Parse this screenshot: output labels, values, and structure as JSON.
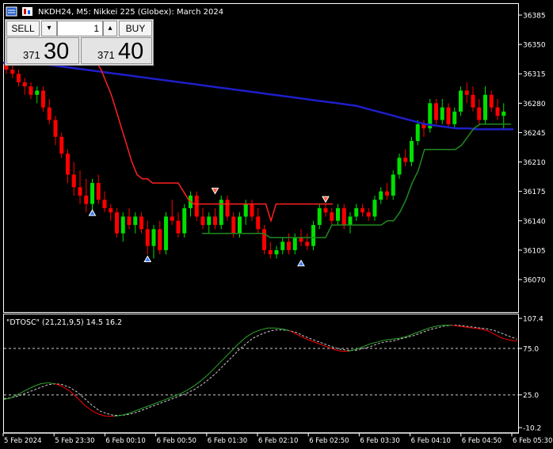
{
  "window": {
    "title": "NKDH24, M5:  Nikkei 225 (Globex): March 2024"
  },
  "trade_panel": {
    "sell_label": "SELL",
    "buy_label": "BUY",
    "volume": "1",
    "down_arrow": "▾",
    "up_arrow": "▴",
    "sell_price_small": "371",
    "sell_price_large": "30",
    "buy_price_small": "371",
    "buy_price_large": "40"
  },
  "indicator": {
    "label": "\"DTOSC\" (21,21,9,5) 14.5 16.2"
  },
  "colors": {
    "bull": "#00e000",
    "bear": "#ff0000",
    "ma": "#1e1ec8",
    "stop_red": "#ff2020",
    "stop_green": "#1f8a1f",
    "osc_main": "#2fa82f",
    "osc_signal": "#c8c8c8",
    "grid": "#ffffff",
    "axis_text": "#ffffff"
  },
  "chart_data": [
    {
      "type": "candlestick",
      "price_axis_ticks": [
        "36385",
        "36350",
        "36315",
        "36280",
        "36245",
        "36210",
        "36175",
        "36140",
        "36105",
        "36070"
      ],
      "ylim": [
        36045,
        36400
      ],
      "x_ticks": [
        "5 Feb 2024",
        "5 Feb 23:30",
        "6 Feb 00:10",
        "6 Feb 00:50",
        "6 Feb 01:30",
        "6 Feb 02:10",
        "6 Feb 02:50",
        "6 Feb 03:30",
        "6 Feb 04:10",
        "6 Feb 04:50",
        "6 Feb 05:30"
      ],
      "candles": [
        [
          36330,
          36335,
          36315,
          36320
        ],
        [
          36320,
          36325,
          36310,
          36315
        ],
        [
          36315,
          36320,
          36300,
          36305
        ],
        [
          36305,
          36310,
          36290,
          36300
        ],
        [
          36300,
          36305,
          36285,
          36290
        ],
        [
          36290,
          36300,
          36280,
          36295
        ],
        [
          36295,
          36300,
          36270,
          36275
        ],
        [
          36275,
          36285,
          36255,
          36260
        ],
        [
          36260,
          36265,
          36230,
          36240
        ],
        [
          36240,
          36245,
          36215,
          36220
        ],
        [
          36220,
          36225,
          36185,
          36195
        ],
        [
          36195,
          36210,
          36170,
          36180
        ],
        [
          36180,
          36200,
          36160,
          36170
        ],
        [
          36170,
          36190,
          36150,
          36160
        ],
        [
          36160,
          36190,
          36150,
          36185
        ],
        [
          36185,
          36195,
          36160,
          36165
        ],
        [
          36165,
          36175,
          36150,
          36155
        ],
        [
          36155,
          36160,
          36140,
          36150
        ],
        [
          36150,
          36155,
          36120,
          36125
        ],
        [
          36125,
          36150,
          36115,
          36145
        ],
        [
          36145,
          36155,
          36130,
          36135
        ],
        [
          36135,
          36150,
          36125,
          36145
        ],
        [
          36145,
          36150,
          36125,
          36130
        ],
        [
          36130,
          36140,
          36100,
          36110
        ],
        [
          36110,
          36135,
          36095,
          36130
        ],
        [
          36130,
          36140,
          36100,
          36105
        ],
        [
          36105,
          36150,
          36100,
          36145
        ],
        [
          36145,
          36165,
          36135,
          36140
        ],
        [
          36140,
          36150,
          36120,
          36125
        ],
        [
          36125,
          36160,
          36120,
          36155
        ],
        [
          36155,
          36175,
          36145,
          36170
        ],
        [
          36170,
          36175,
          36140,
          36145
        ],
        [
          36145,
          36155,
          36130,
          36135
        ],
        [
          36135,
          36150,
          36125,
          36145
        ],
        [
          36145,
          36155,
          36130,
          36135
        ],
        [
          36135,
          36170,
          36130,
          36165
        ],
        [
          36165,
          36170,
          36140,
          36145
        ],
        [
          36145,
          36150,
          36120,
          36125
        ],
        [
          36125,
          36150,
          36120,
          36145
        ],
        [
          36145,
          36165,
          36135,
          36160
        ],
        [
          36160,
          36165,
          36140,
          36145
        ],
        [
          36145,
          36155,
          36125,
          36130
        ],
        [
          36130,
          36135,
          36100,
          36105
        ],
        [
          36105,
          36115,
          36095,
          36100
        ],
        [
          36100,
          36110,
          36095,
          36105
        ],
        [
          36105,
          36120,
          36100,
          36115
        ],
        [
          36115,
          36125,
          36100,
          36105
        ],
        [
          36105,
          36125,
          36100,
          36120
        ],
        [
          36120,
          36130,
          36110,
          36115
        ],
        [
          36115,
          36125,
          36105,
          36110
        ],
        [
          36110,
          36140,
          36105,
          36135
        ],
        [
          36135,
          36160,
          36130,
          36155
        ],
        [
          36155,
          36160,
          36145,
          36150
        ],
        [
          36150,
          36155,
          36135,
          36140
        ],
        [
          36140,
          36160,
          36135,
          36155
        ],
        [
          36155,
          36160,
          36130,
          36135
        ],
        [
          36135,
          36150,
          36125,
          36145
        ],
        [
          36145,
          36160,
          36140,
          36155
        ],
        [
          36155,
          36160,
          36145,
          36150
        ],
        [
          36150,
          36155,
          36140,
          36145
        ],
        [
          36145,
          36170,
          36140,
          36165
        ],
        [
          36165,
          36180,
          36160,
          36175
        ],
        [
          36175,
          36185,
          36165,
          36170
        ],
        [
          36170,
          36200,
          36165,
          36195
        ],
        [
          36195,
          36220,
          36190,
          36215
        ],
        [
          36215,
          36225,
          36205,
          36210
        ],
        [
          36210,
          36240,
          36205,
          36235
        ],
        [
          36235,
          36260,
          36230,
          36255
        ],
        [
          36255,
          36260,
          36240,
          36250
        ],
        [
          36250,
          36285,
          36245,
          36280
        ],
        [
          36280,
          36285,
          36255,
          36260
        ],
        [
          36260,
          36285,
          36255,
          36275
        ],
        [
          36275,
          36280,
          36250,
          36255
        ],
        [
          36255,
          36275,
          36250,
          36270
        ],
        [
          36270,
          36300,
          36265,
          36295
        ],
        [
          36295,
          36305,
          36280,
          36290
        ],
        [
          36290,
          36300,
          36270,
          36275
        ],
        [
          36275,
          36285,
          36255,
          36260
        ],
        [
          36260,
          36300,
          36255,
          36290
        ],
        [
          36290,
          36295,
          36270,
          36275
        ],
        [
          36275,
          36285,
          36260,
          36265
        ],
        [
          36265,
          36280,
          36250,
          36270
        ]
      ],
      "ma": [
        36328,
        36329,
        36329,
        36329,
        36328,
        36328,
        36327,
        36326,
        36325,
        36324,
        36323,
        36322,
        36321,
        36320,
        36319,
        36318,
        36317,
        36316,
        36315,
        36314,
        36313,
        36312,
        36311,
        36310,
        36309,
        36308,
        36307,
        36306,
        36305,
        36304,
        36303,
        36302,
        36301,
        36300,
        36299,
        36298,
        36297,
        36296,
        36295,
        36294,
        36293,
        36292,
        36291,
        36290,
        36289,
        36288,
        36287,
        36286,
        36285,
        36284,
        36283,
        36282,
        36281,
        36280,
        36279,
        36278,
        36277,
        36275,
        36273,
        36271,
        36269,
        36267,
        36265,
        36263,
        36261,
        36259,
        36257,
        36255,
        36254,
        36253,
        36252,
        36251,
        36250,
        36250,
        36250,
        36249,
        36249,
        36249,
        36249,
        36249,
        36249,
        36249
      ],
      "stop_red": [
        36340,
        36340,
        36340,
        36335,
        36330,
        36320,
        36305,
        36290,
        36270,
        36250,
        36230,
        36210,
        36195,
        36190,
        36190,
        36185,
        36185,
        36185,
        36185,
        36185,
        36185,
        36175,
        36165,
        36160,
        36160,
        36160,
        36160,
        36160,
        36160,
        36160,
        36160,
        36160,
        36160,
        36160,
        36160,
        36160,
        36160,
        36160,
        36140,
        36160,
        36160,
        36160,
        36160,
        36160,
        36160,
        36160,
        36160,
        36160,
        36160,
        36160,
        36160
      ],
      "stop_green": [
        36125,
        36125,
        36125,
        36125,
        36125,
        36125,
        36125,
        36125,
        36125,
        36125,
        36125,
        36120,
        36120,
        36120,
        36120,
        36120,
        36120,
        36120,
        36120,
        36120,
        36120,
        36135,
        36135,
        36135,
        36135,
        36135,
        36135,
        36135,
        36135,
        36135,
        36140,
        36140,
        36150,
        36165,
        36185,
        36200,
        36225,
        36225,
        36225,
        36225,
        36225,
        36225,
        36230,
        36240,
        36250,
        36255,
        36255,
        36255,
        36255,
        36255,
        36255
      ],
      "arrows": [
        {
          "i": 14,
          "price": 36150,
          "dir": "up"
        },
        {
          "i": 23,
          "price": 36095,
          "dir": "up"
        },
        {
          "i": 34,
          "price": 36175,
          "dir": "down"
        },
        {
          "i": 48,
          "price": 36090,
          "dir": "up"
        },
        {
          "i": 52,
          "price": 36165,
          "dir": "down"
        }
      ]
    },
    {
      "type": "line",
      "name": "DTOSC",
      "ylim": [
        -10.2,
        107.4
      ],
      "y_ticks": [
        "107.4",
        "75.0",
        "25.0",
        "-10.2"
      ],
      "levels": [
        75,
        25
      ],
      "main": [
        20,
        22,
        26,
        30,
        34,
        37,
        38,
        37,
        34,
        29,
        22,
        14,
        8,
        4,
        2,
        2,
        3,
        5,
        8,
        11,
        14,
        17,
        20,
        23,
        26,
        30,
        35,
        41,
        48,
        56,
        64,
        72,
        80,
        87,
        92,
        95,
        97,
        97,
        96,
        94,
        90,
        86,
        83,
        80,
        77,
        74,
        72,
        72,
        74,
        77,
        80,
        82,
        84,
        85,
        86,
        88,
        91,
        94,
        97,
        99,
        100,
        100,
        99,
        98,
        97,
        96,
        94,
        90,
        86,
        84,
        83
      ],
      "signal": [
        21,
        22,
        24,
        27,
        30,
        33,
        36,
        37,
        36,
        33,
        28,
        21,
        14,
        8,
        5,
        3,
        3,
        4,
        6,
        9,
        12,
        15,
        18,
        21,
        24,
        27,
        31,
        36,
        42,
        49,
        57,
        65,
        73,
        80,
        86,
        90,
        93,
        95,
        95,
        94,
        92,
        88,
        85,
        82,
        79,
        76,
        74,
        73,
        73,
        75,
        77,
        80,
        82,
        83,
        85,
        87,
        89,
        92,
        95,
        97,
        99,
        100,
        100,
        99,
        98,
        97,
        96,
        94,
        91,
        88,
        85
      ]
    }
  ]
}
